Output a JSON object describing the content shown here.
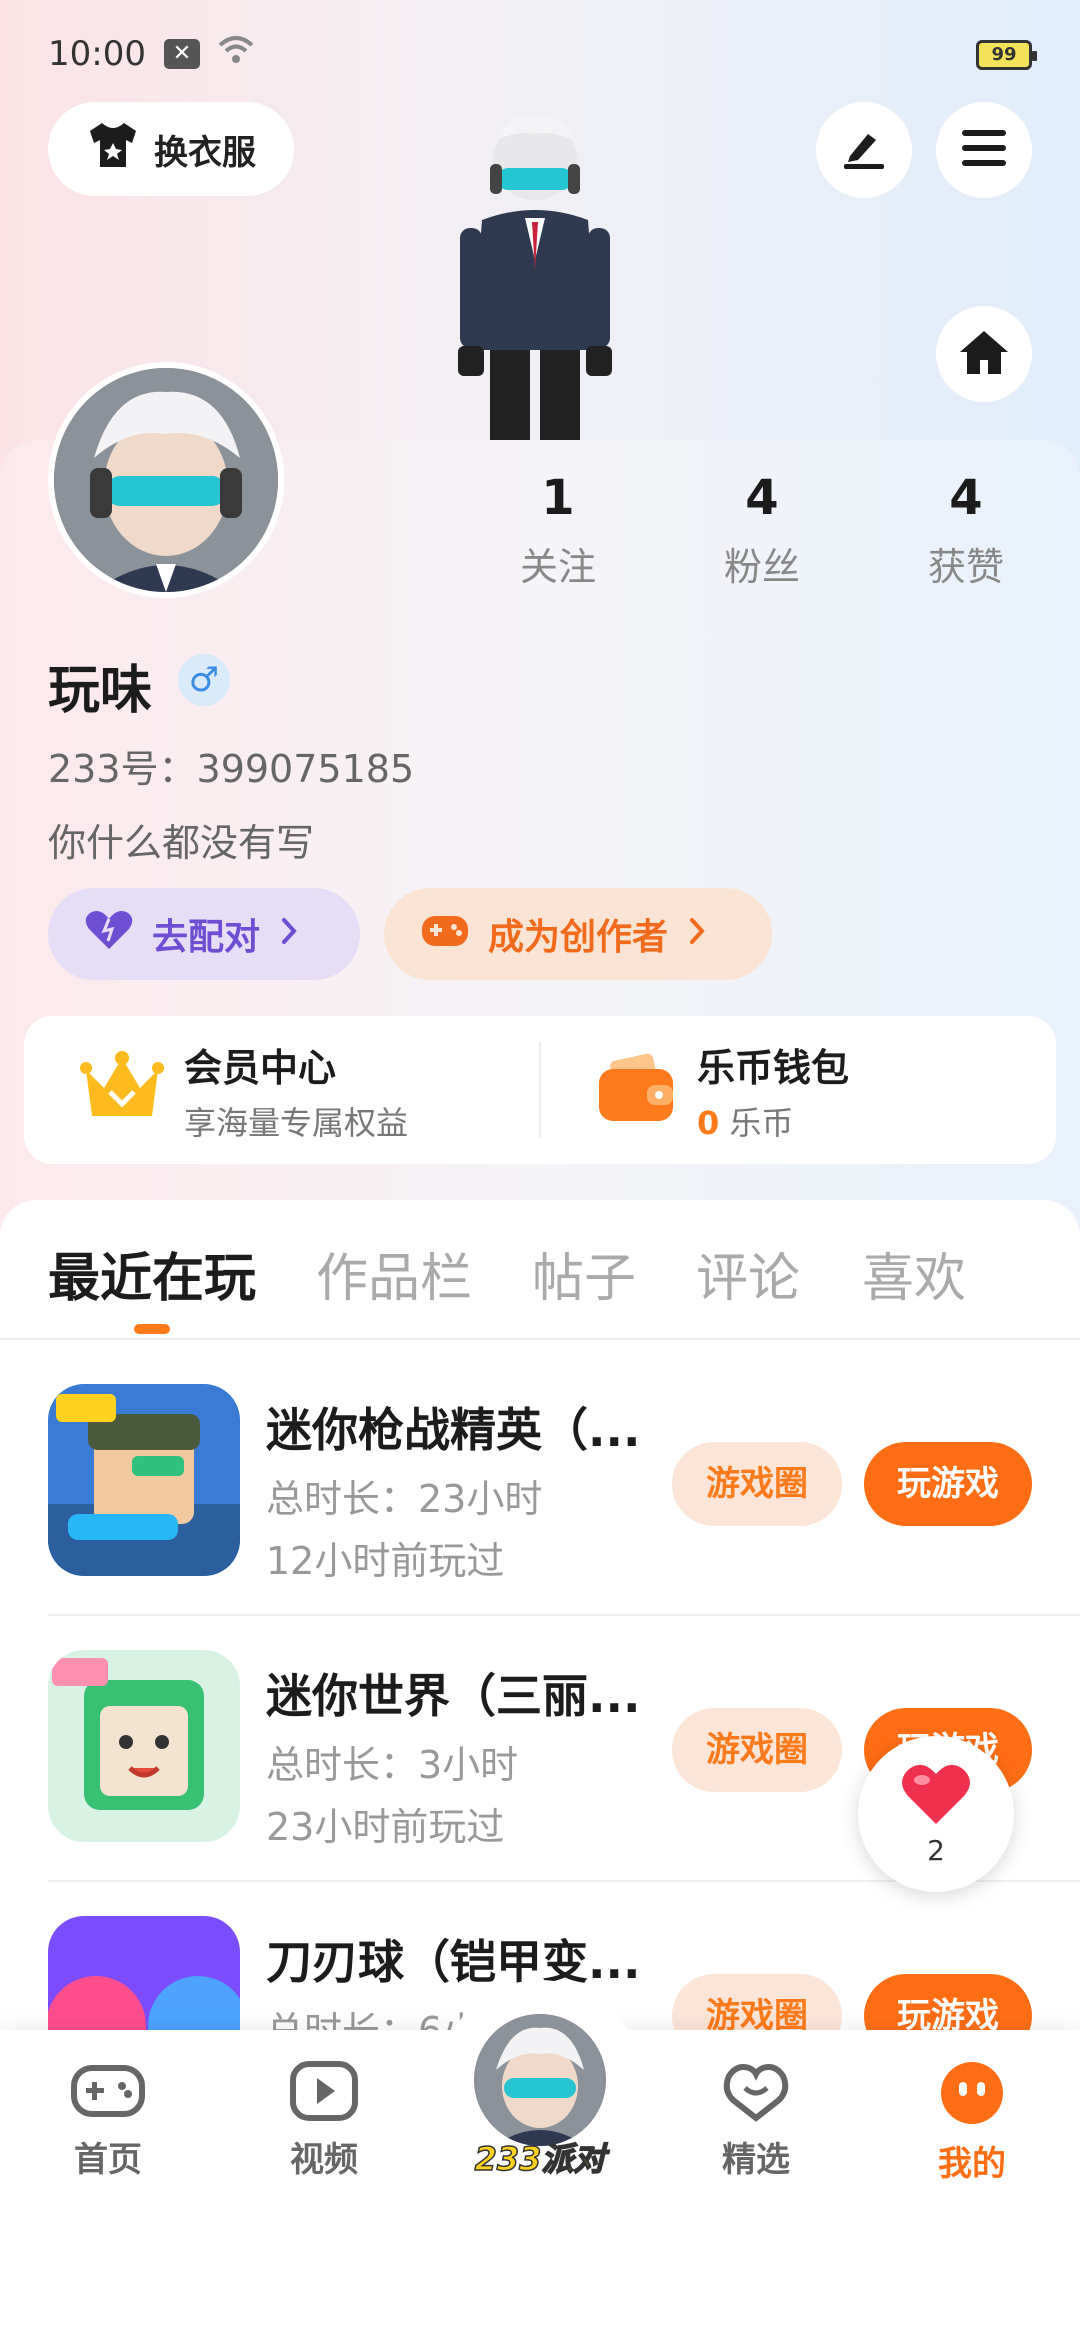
{
  "status_bar": {
    "time": "10:00",
    "battery": "99"
  },
  "header": {
    "change_clothes_label": "换衣服",
    "icons": [
      "shirt-icon",
      "edit-icon",
      "menu-icon",
      "home-icon"
    ]
  },
  "profile": {
    "stats": [
      {
        "num": "1",
        "label": "关注"
      },
      {
        "num": "4",
        "label": "粉丝"
      },
      {
        "num": "4",
        "label": "获赞"
      }
    ],
    "nickname": "玩味",
    "gender_symbol": "♂",
    "uid": "233号：399075185",
    "bio": "你什么都没有写",
    "match_label": "去配对",
    "creator_label": "成为创作者"
  },
  "member": {
    "vip_title": "会员中心",
    "vip_sub": "享海量专属权益",
    "wallet_title": "乐币钱包",
    "wallet_amount": "0",
    "wallet_unit": "乐币"
  },
  "tabs": [
    "最近在玩",
    "作品栏",
    "帖子",
    "评论",
    "喜欢"
  ],
  "active_tab": "最近在玩",
  "games": [
    {
      "name": "迷你枪战精英（...",
      "duration": "总时长：23小时",
      "last_played": "12小时前玩过",
      "circle_label": "游戏圈",
      "play_label": "玩游戏"
    },
    {
      "name": "迷你世界（三丽...",
      "duration": "总时长：3小时",
      "last_played": "23小时前玩过",
      "circle_label": "游戏圈",
      "play_label": "玩游戏"
    },
    {
      "name": "刀刃球（铠甲变...",
      "duration": "总时长：6小",
      "last_played": "",
      "circle_label": "游戏圈",
      "play_label": "玩游戏"
    }
  ],
  "floating_like": {
    "count": "2"
  },
  "bottom_nav": {
    "items": [
      {
        "label": "首页",
        "icon": "gamepad-icon"
      },
      {
        "label": "视频",
        "icon": "play-icon"
      },
      {
        "label": "233派对",
        "icon": "party-avatar"
      },
      {
        "label": "精选",
        "icon": "heart-chat-icon"
      },
      {
        "label": "我的",
        "icon": "face-icon"
      }
    ],
    "active": "我的"
  },
  "colors": {
    "accent": "#ff6e14",
    "purple": "#6e4fd3",
    "gender_blue": "#3b8ce6"
  }
}
